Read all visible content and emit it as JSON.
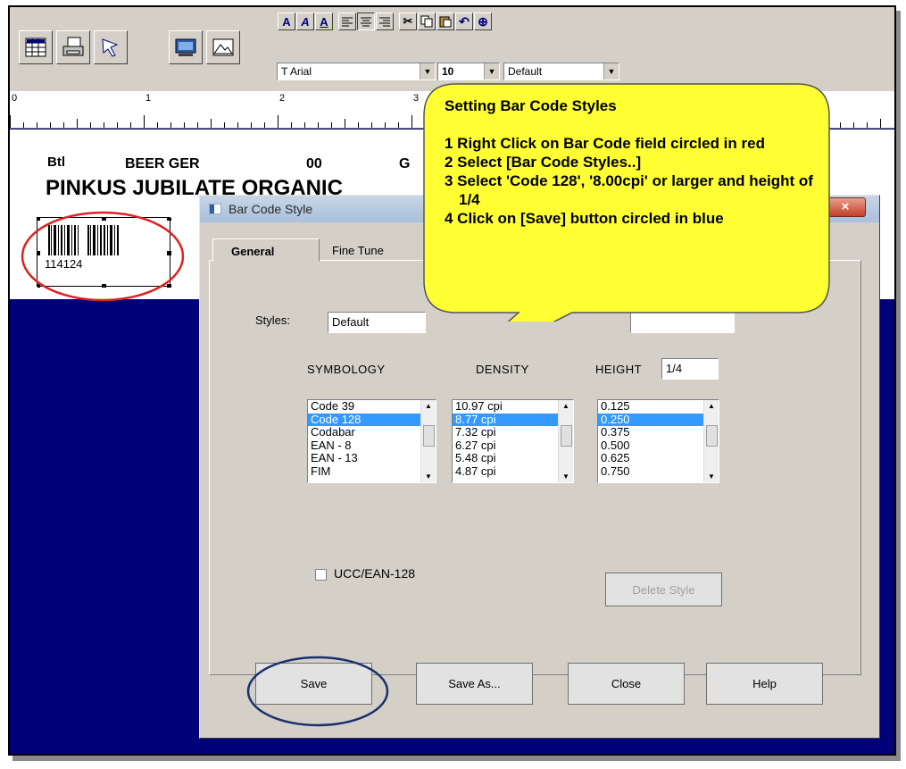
{
  "toolbar": {
    "format_buttons": [
      "A",
      "A",
      "A"
    ],
    "font_name": "Arial",
    "font_size": "10",
    "style_value": "Default"
  },
  "ruler": {
    "numbers": [
      "0",
      "1",
      "2",
      "3"
    ]
  },
  "label": {
    "field_btl": "Btl",
    "field_beer": "BEER GER",
    "field_code": "00",
    "field_g": "G",
    "product_name": "PINKUS JUBILATE ORGANIC",
    "barcode_number": "114124"
  },
  "dialog": {
    "title": "Bar Code Style",
    "close_glyph": "×",
    "tabs": {
      "general": "General",
      "fine_tune": "Fine Tune"
    },
    "styles_label": "Styles:",
    "styles_value": "Default",
    "symbology_header": "SYMBOLOGY",
    "density_header": "DENSITY",
    "height_header": "HEIGHT",
    "height_value": "1/4",
    "symbology_items": [
      "Code 39",
      "Code 128",
      "Codabar",
      "EAN - 8",
      "EAN - 13",
      "FIM"
    ],
    "density_items": [
      "10.97 cpi",
      "8.77 cpi",
      "7.32 cpi",
      "6.27 cpi",
      "5.48 cpi",
      "4.87 cpi"
    ],
    "height_items": [
      "0.125",
      "0.250",
      "0.375",
      "0.500",
      "0.625",
      "0.750"
    ],
    "ucc_label": "UCC/EAN-128",
    "delete_style": "Delete Style",
    "buttons": {
      "save": "Save",
      "save_as": "Save As...",
      "close": "Close",
      "help": "Help"
    }
  },
  "callout": {
    "title": "Setting Bar Code Styles",
    "step1": "1 Right Click on Bar Code field circled in red",
    "step2": "2 Select [Bar Code Styles..]",
    "step3": "3 Select  'Code 128', '8.00cpi' or larger and height of 1/4",
    "step4": "4 Click on [Save] button circled in blue"
  },
  "colors": {
    "background_blue": "#000078",
    "callout_fill": "#ffff33",
    "red_circle": "#dd2222",
    "blue_circle": "#1a2f6e",
    "selection": "#3399ff"
  }
}
